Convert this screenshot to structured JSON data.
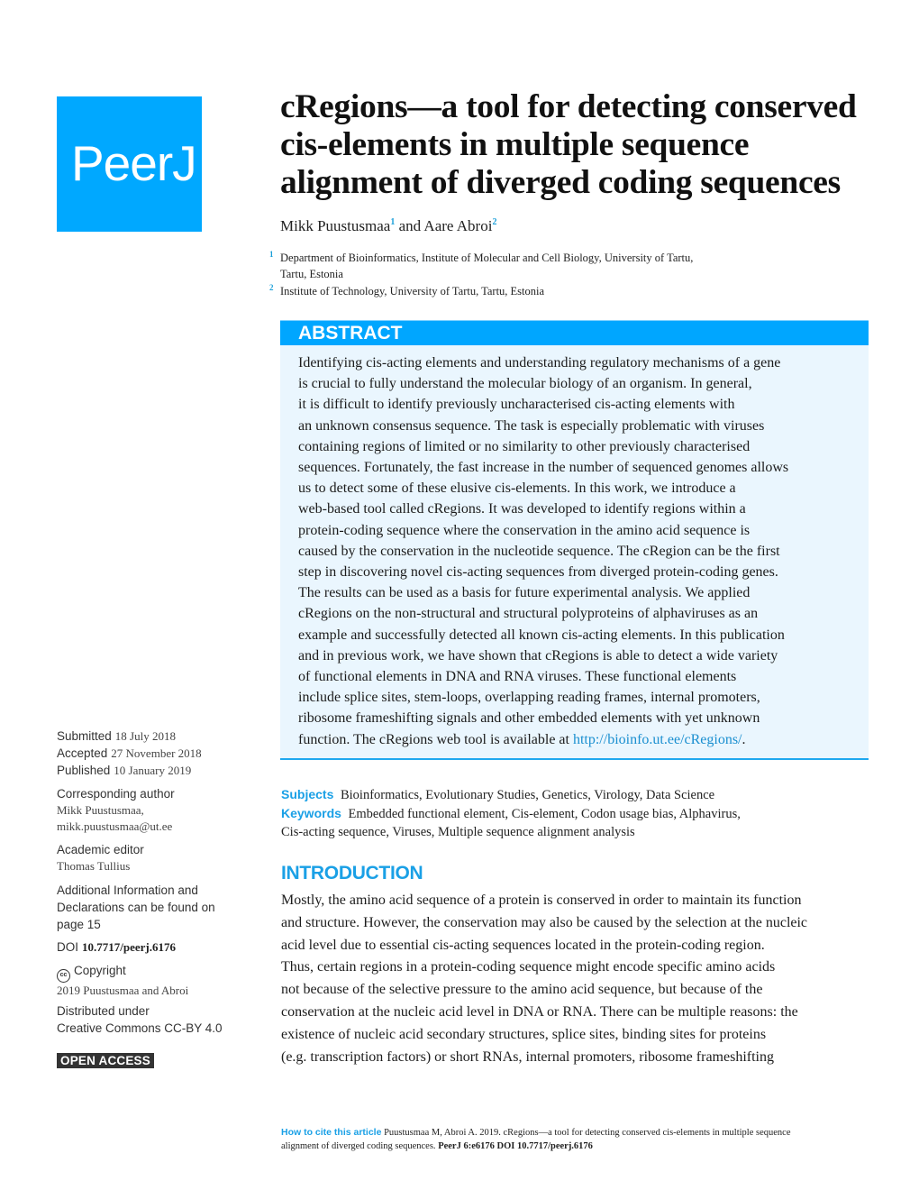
{
  "logo": {
    "text": "PeerJ",
    "color": "#00a8ff"
  },
  "title": {
    "lines": [
      "cRegions—a tool for detecting conserved",
      "cis-elements in multiple sequence",
      "alignment of diverged coding sequences"
    ]
  },
  "authors": [
    {
      "name": "Mikk Puustusmaa",
      "affil": "1"
    },
    {
      "name": "Aare Abroi",
      "affil": "2"
    }
  ],
  "authors_joiner": " and ",
  "affiliations": [
    {
      "num": "1",
      "lines": [
        "Department of Bioinformatics, Institute of Molecular and Cell Biology, University of Tartu,",
        "Tartu, Estonia"
      ]
    },
    {
      "num": "2",
      "lines": [
        "Institute of Technology, University of Tartu, Tartu, Estonia"
      ]
    }
  ],
  "abstract": {
    "heading": "ABSTRACT",
    "lines": [
      "Identifying cis-acting elements and understanding regulatory mechanisms of a gene",
      "is crucial to fully understand the molecular biology of an organism. In general,",
      "it is difficult to identify previously uncharacterised cis-acting elements with",
      "an unknown consensus sequence. The task is especially problematic with viruses",
      "containing regions of limited or no similarity to other previously characterised",
      "sequences. Fortunately, the fast increase in the number of sequenced genomes allows",
      "us to detect some of these elusive cis-elements. In this work, we introduce a",
      "web-based tool called cRegions. It was developed to identify regions within a",
      "protein-coding sequence where the conservation in the amino acid sequence is",
      "caused by the conservation in the nucleotide sequence. The cRegion can be the first",
      "step in discovering novel cis-acting sequences from diverged protein-coding genes.",
      "The results can be used as a basis for future experimental analysis. We applied",
      "cRegions on the non-structural and structural polyproteins of alphaviruses as an",
      "example and successfully detected all known cis-acting elements. In this publication",
      "and in previous work, we have shown that cRegions is able to detect a wide variety",
      "of functional elements in DNA and RNA viruses. These functional elements",
      "include splice sites, stem-loops, overlapping reading frames, internal promoters,",
      "ribosome frameshifting signals and other embedded elements with yet unknown"
    ],
    "last_line_prefix": "function. The cRegions web tool is available at ",
    "link": "http://bioinfo.ut.ee/cRegions/",
    "last_line_suffix": "."
  },
  "sidebar": {
    "submitted_label": "Submitted",
    "submitted_value": "18 July 2018",
    "accepted_label": "Accepted",
    "accepted_value": "27 November 2018",
    "published_label": "Published",
    "published_value": "10 January 2019",
    "corresponding_label": "Corresponding author",
    "corresponding_name": "Mikk Puustusmaa,",
    "corresponding_email": "mikk.puustusmaa@ut.ee",
    "editor_label": "Academic editor",
    "editor_name": "Thomas Tullius",
    "additional_lines": [
      "Additional Information and",
      "Declarations can be found on",
      "page 15"
    ],
    "doi_label": "DOI",
    "doi_value": "10.7717/peerj.6176",
    "cc_icon": "cc",
    "copyright_label": "Copyright",
    "copyright_value": "2019 Puustusmaa and Abroi",
    "distributed_lines": [
      "Distributed under",
      "Creative Commons CC-BY 4.0"
    ],
    "open_access": "OPEN ACCESS"
  },
  "meta": {
    "subjects_label": "Subjects",
    "subjects_value": "Bioinformatics, Evolutionary Studies, Genetics, Virology, Data Science",
    "keywords_label": "Keywords",
    "keywords_line1": "Embedded functional element, Cis-element, Codon usage bias, Alphavirus,",
    "keywords_line2": "Cis-acting sequence, Viruses, Multiple sequence alignment analysis"
  },
  "introduction": {
    "heading": "INTRODUCTION",
    "lines": [
      "Mostly, the amino acid sequence of a protein is conserved in order to maintain its function",
      "and structure. However, the conservation may also be caused by the selection at the nucleic",
      "acid level due to essential cis-acting sequences located in the protein-coding region.",
      "Thus, certain regions in a protein-coding sequence might encode specific amino acids",
      "not because of the selective pressure to the amino acid sequence, but because of the",
      "conservation at the nucleic acid level in DNA or RNA. There can be multiple reasons: the",
      "existence of nucleic acid secondary structures, splice sites, binding sites for proteins",
      "(e.g. transcription factors) or short RNAs, internal promoters, ribosome frameshifting"
    ]
  },
  "citation": {
    "label": "How to cite this article",
    "text1": "Puustusmaa M, Abroi A. 2019. cRegions—a tool for detecting conserved cis-elements in multiple sequence",
    "text2": "alignment of diverged coding sequences. ",
    "journal": "PeerJ 6:e6176 DOI 10.7717/peerj.6176"
  }
}
